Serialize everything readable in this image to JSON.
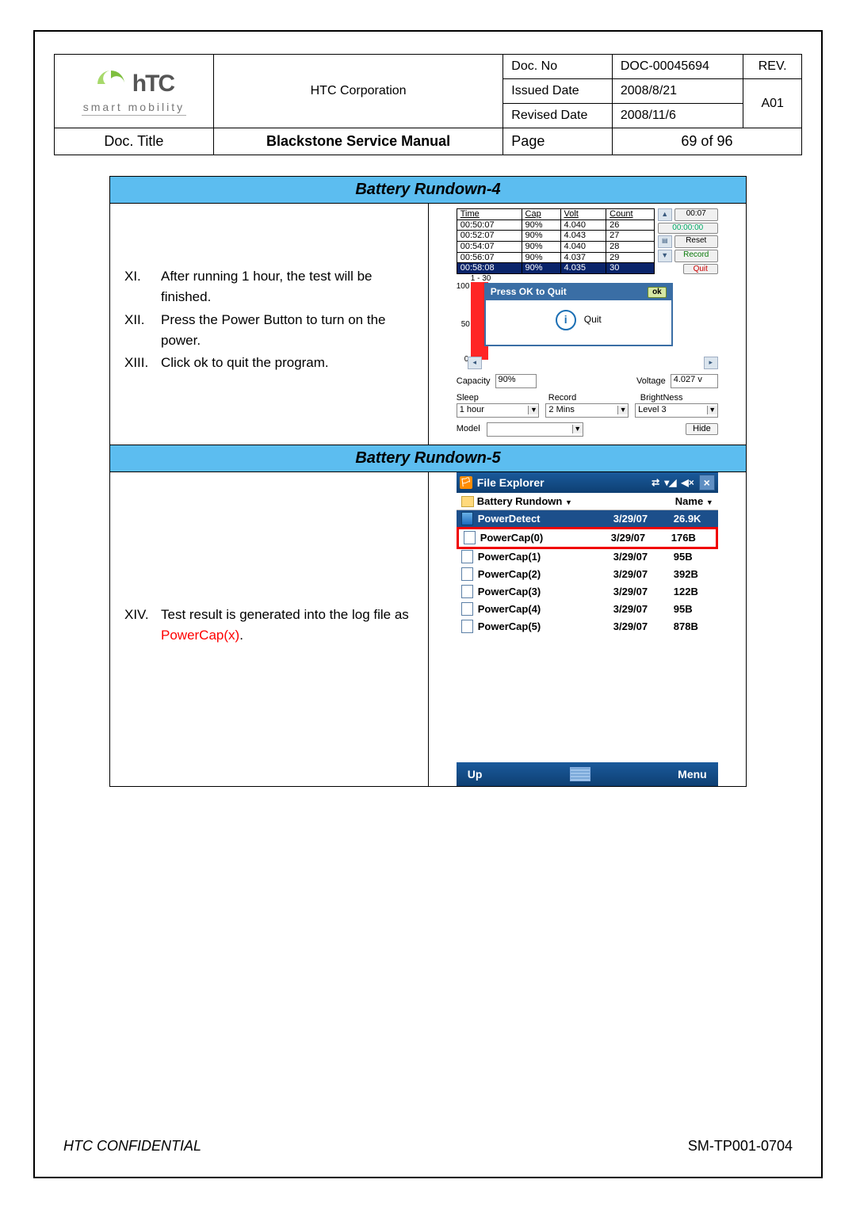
{
  "header": {
    "corporation": "HTC Corporation",
    "logo_sub": "smart mobility",
    "docno_label": "Doc. No",
    "docno": "DOC-00045694",
    "rev_label": "REV.",
    "issued_label": "Issued Date",
    "issued": "2008/8/21",
    "rev": "A01",
    "revised_label": "Revised Date",
    "revised": "2008/11/6",
    "doctitle_label": "Doc. Title",
    "doctitle": "Blackstone Service Manual",
    "page_label": "Page",
    "pageval": "69  of  96"
  },
  "section4": {
    "title": "Battery Rundown-4",
    "items": [
      {
        "num": "XI.",
        "text": "After running 1 hour, the test will be finished."
      },
      {
        "num": "XII.",
        "text": "Press the Power Button to turn on the power."
      },
      {
        "num": "XIII.",
        "text": "Click ok to quit the program."
      }
    ],
    "device": {
      "cols": [
        "Time",
        "Cap",
        "Volt",
        "Count"
      ],
      "rows": [
        {
          "time": "00:50:07",
          "cap": "90%",
          "volt": "4.040",
          "count": "26"
        },
        {
          "time": "00:52:07",
          "cap": "90%",
          "volt": "4.043",
          "count": "27"
        },
        {
          "time": "00:54:07",
          "cap": "90%",
          "volt": "4.040",
          "count": "28"
        },
        {
          "time": "00:56:07",
          "cap": "90%",
          "volt": "4.037",
          "count": "29"
        },
        {
          "time": "00:58:08",
          "cap": "90%",
          "volt": "4.035",
          "count": "30"
        }
      ],
      "clock": "00:07",
      "elapsed": "00:00:00",
      "btn_reset": "Reset",
      "btn_record": "Record",
      "btn_quit": "Quit",
      "chart_range": "1 - 30",
      "dlg_title": "Press OK to Quit",
      "dlg_ok": "ok",
      "dlg_body": "Quit",
      "capacity_label": "Capacity",
      "capacity": "90%",
      "voltage_label": "Voltage",
      "voltage": "4.027 v",
      "sleep_label": "Sleep",
      "sleep": "1 hour",
      "record_label": "Record",
      "record": "2 Mins",
      "bright_label": "BrightNess",
      "bright": "Level 3",
      "model_label": "Model",
      "hide": "Hide"
    }
  },
  "section5": {
    "title": "Battery Rundown-5",
    "instr_num": "XIV.",
    "instr_text_a": "Test result is generated into the log file as ",
    "instr_text_red": "PowerCap(x)",
    "instr_text_b": ".",
    "device": {
      "title": "File Explorer",
      "path_left": "Battery Rundown",
      "path_right": "Name",
      "files": [
        {
          "name": "PowerDetect",
          "date": "3/29/07",
          "size": "26.9K",
          "sel": true,
          "exe": true
        },
        {
          "name": "PowerCap(0)",
          "date": "3/29/07",
          "size": "176B",
          "hl": true
        },
        {
          "name": "PowerCap(1)",
          "date": "3/29/07",
          "size": "95B"
        },
        {
          "name": "PowerCap(2)",
          "date": "3/29/07",
          "size": "392B"
        },
        {
          "name": "PowerCap(3)",
          "date": "3/29/07",
          "size": "122B"
        },
        {
          "name": "PowerCap(4)",
          "date": "3/29/07",
          "size": "95B"
        },
        {
          "name": "PowerCap(5)",
          "date": "3/29/07",
          "size": "878B"
        }
      ],
      "up": "Up",
      "menu": "Menu"
    }
  },
  "footer": {
    "left": "HTC CONFIDENTIAL",
    "right": "SM-TP001-0704"
  }
}
